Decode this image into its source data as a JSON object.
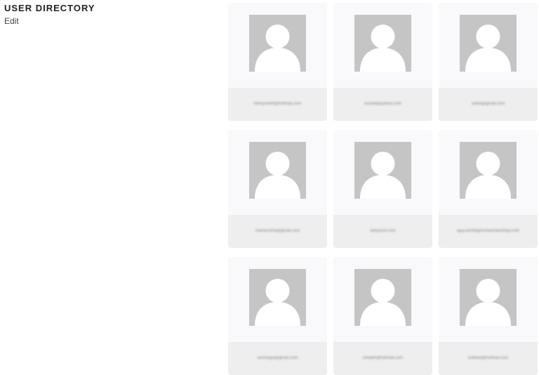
{
  "header": {
    "title": "USER DIRECTORY",
    "edit_label": "Edit"
  },
  "icons": {
    "avatar": "person-placeholder-icon"
  },
  "colors": {
    "card_bg": "#f7f7f9",
    "email_band": "#eeeeef",
    "avatar_bg": "#c5c5c5"
  },
  "users": [
    {
      "email": "henrysmith@hotmail.com"
    },
    {
      "email": "rozalia@yahoo.com"
    },
    {
      "email": "sahiti@gmail.com"
    },
    {
      "email": "marianntha@gmail.com"
    },
    {
      "email": "liamjoshi.com"
    },
    {
      "email": "ajuy.amitfaghichandrakorbay.com"
    },
    {
      "email": "ranimaya@gmail.com"
    },
    {
      "email": "sreejith@hotmail.com"
    },
    {
      "email": "kobbuk@hotmail.com"
    }
  ]
}
